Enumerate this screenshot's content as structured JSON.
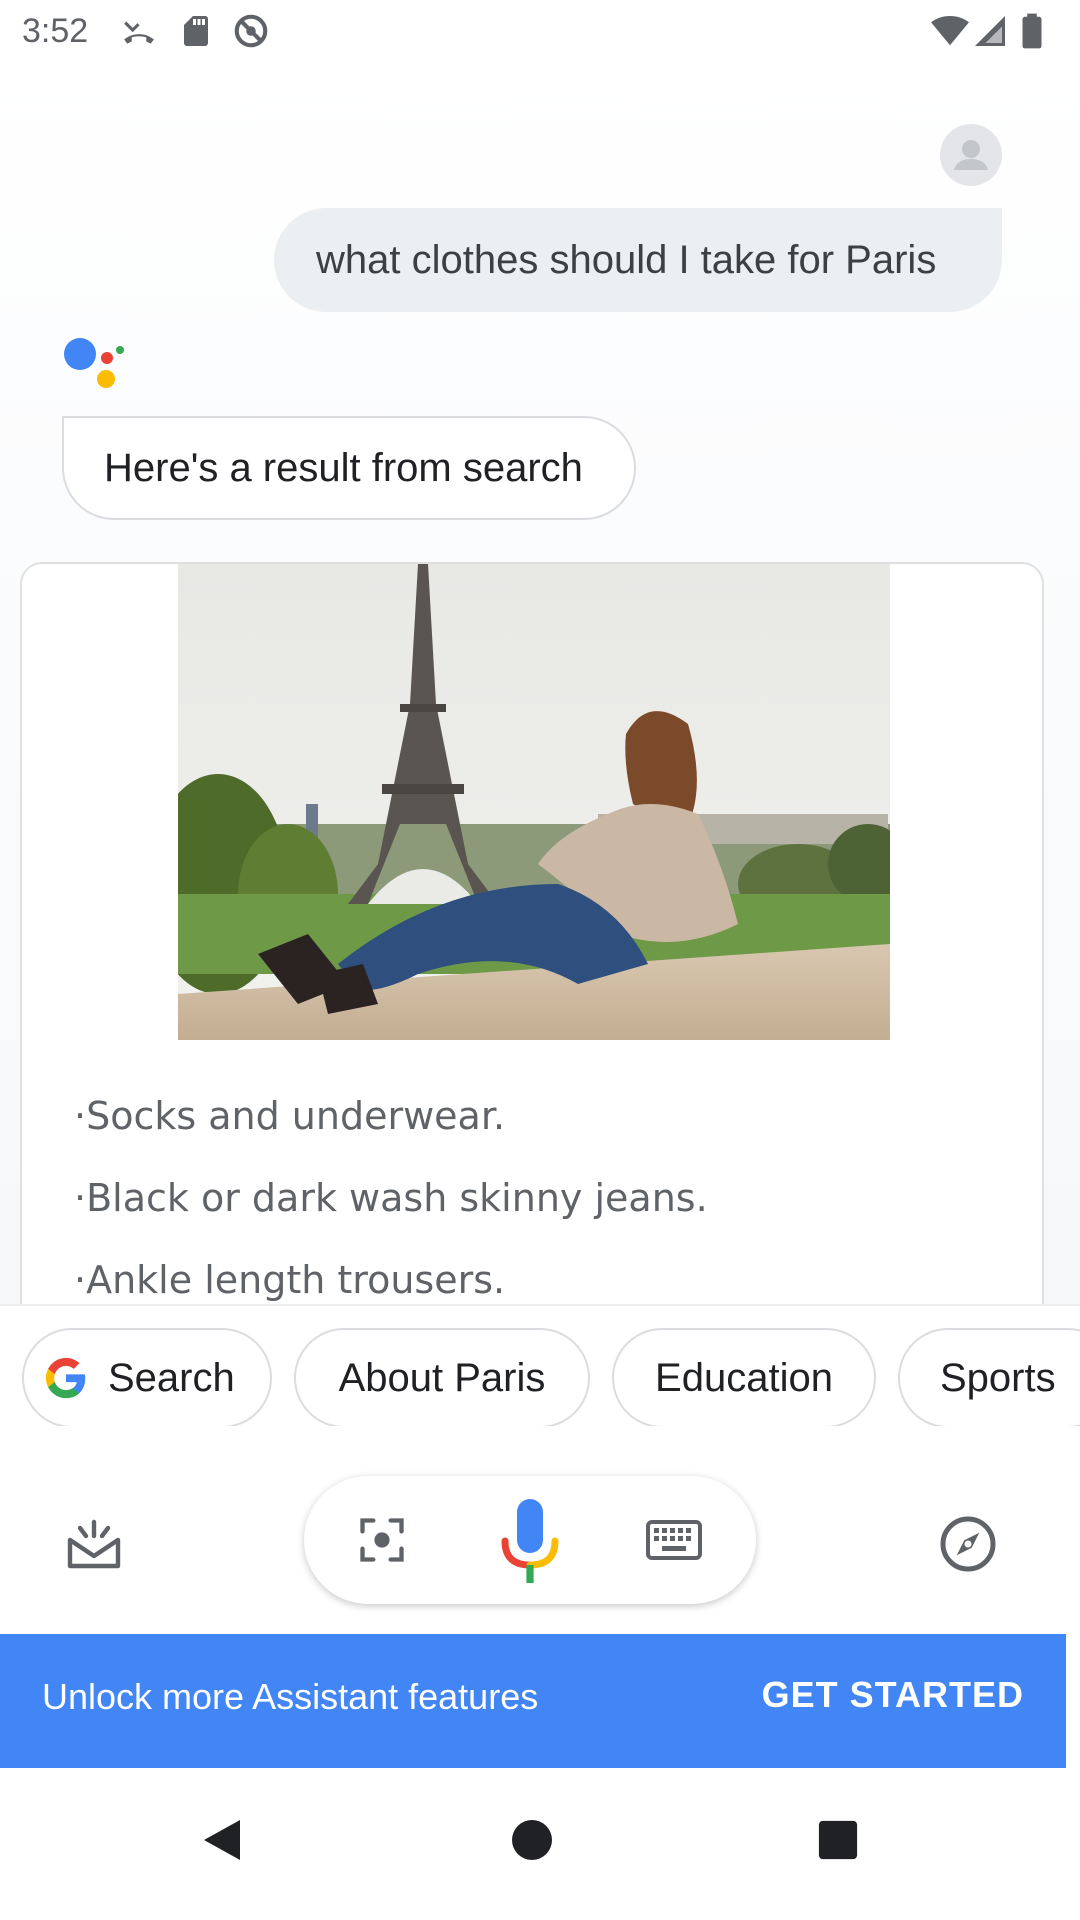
{
  "status_bar": {
    "time": "3:52",
    "icons": [
      "missed-call-icon",
      "sd-card-icon",
      "do-not-disturb-icon",
      "wifi-icon",
      "cellular-signal-icon",
      "battery-icon"
    ]
  },
  "conversation": {
    "user_query": "what clothes should I take for Paris",
    "assistant_reply": "Here's a result from search",
    "result": {
      "image_alt": "Woman sitting in front of the Eiffel Tower",
      "items": [
        "Socks and underwear.",
        "Black or dark wash skinny jeans.",
        "Ankle length trousers."
      ]
    }
  },
  "suggestions": [
    {
      "label": "Search",
      "icon": "google-g-icon"
    },
    {
      "label": "About Paris"
    },
    {
      "label": "Education"
    },
    {
      "label": "Sports"
    }
  ],
  "bottom_bar": {
    "icons": [
      "snapshot-icon",
      "lens-icon",
      "mic-icon",
      "keyboard-icon",
      "explore-compass-icon"
    ]
  },
  "banner": {
    "text": "Unlock more Assistant features",
    "cta": "GET STARTED",
    "color": "#4285f4"
  },
  "nav": {
    "icons": [
      "back-icon",
      "home-icon",
      "recents-icon"
    ]
  },
  "colors": {
    "google_blue": "#4285f4",
    "google_red": "#ea4335",
    "google_yellow": "#fbbc05",
    "google_green": "#34a853"
  }
}
